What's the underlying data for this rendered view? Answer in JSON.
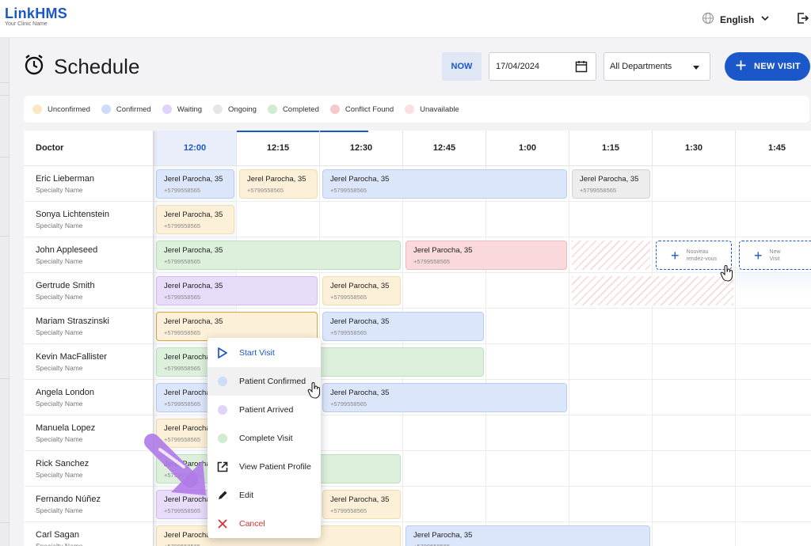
{
  "header": {
    "logo": "LinkHMS",
    "logo_sub": "Your Clinic Name",
    "language": "English"
  },
  "page": {
    "title": "Schedule",
    "now_label": "NOW",
    "date_value": "17/04/2024",
    "department_value": "All Departments",
    "new_visit_label": "NEW VISIT"
  },
  "legend": [
    {
      "label": "Unconfirmed",
      "color": "#fbe7c4"
    },
    {
      "label": "Confirmed",
      "color": "#cfdcf8"
    },
    {
      "label": "Waiting",
      "color": "#e0d2fa"
    },
    {
      "label": "Ongoing",
      "color": "#e6e6e6"
    },
    {
      "label": "Completed",
      "color": "#d2ecd2"
    },
    {
      "label": "Conflict Found",
      "color": "#f6c9cd"
    },
    {
      "label": "Unavailable",
      "color": "#fbe0e2"
    }
  ],
  "grid": {
    "doctor_header": "Doctor",
    "times": [
      "12:00",
      "12:15",
      "12:30",
      "12:45",
      "1:00",
      "1:15",
      "1:30",
      "1:45"
    ],
    "active_time": "12:00",
    "doctors": [
      {
        "name": "Eric Lieberman",
        "specialty": "Specialty Name"
      },
      {
        "name": "Sonya Lichtenstein",
        "specialty": "Specialty Name"
      },
      {
        "name": "John Appleseed",
        "specialty": "Specialty Name"
      },
      {
        "name": "Gertrude Smith",
        "specialty": "Specialty Name"
      },
      {
        "name": "Mariam Straszinski",
        "specialty": "Specialty Name"
      },
      {
        "name": "Kevin MacFallister",
        "specialty": "Specialty Name"
      },
      {
        "name": "Angela London",
        "specialty": "Specialty Name"
      },
      {
        "name": "Manuela Lopez",
        "specialty": "Specialty Name"
      },
      {
        "name": "Rick Sanchez",
        "specialty": "Specialty Name"
      },
      {
        "name": "Fernando Núñez",
        "specialty": "Specialty Name"
      },
      {
        "name": "Carl Sagan",
        "specialty": "Specialty Name"
      }
    ],
    "appointments": [
      {
        "row": 0,
        "start": 0,
        "span": 1,
        "status": "confirmed",
        "patient": "Jerel Parocha, 35",
        "phone": "+5799558565"
      },
      {
        "row": 0,
        "start": 1,
        "span": 1,
        "status": "unconfirmed",
        "patient": "Jerel Parocha, 35",
        "phone": "+5799558565"
      },
      {
        "row": 0,
        "start": 2,
        "span": 3,
        "status": "confirmed",
        "patient": "Jerel Parocha, 35",
        "phone": "+5799558565"
      },
      {
        "row": 0,
        "start": 5,
        "span": 1,
        "status": "ongoing",
        "patient": "Jerel Parocha, 35",
        "phone": "+5799558565"
      },
      {
        "row": 1,
        "start": 0,
        "span": 1,
        "status": "unconfirmed",
        "patient": "Jerel Parocha, 35",
        "phone": "+5799558565"
      },
      {
        "row": 2,
        "start": 0,
        "span": 3,
        "status": "completed",
        "patient": "Jerel Parocha, 35",
        "phone": "+5799558565"
      },
      {
        "row": 2,
        "start": 3,
        "span": 2,
        "status": "conflict",
        "patient": "Jerel Parocha, 35",
        "phone": "+5799558565"
      },
      {
        "row": 3,
        "start": 0,
        "span": 2,
        "status": "waiting",
        "patient": "Jerel Parocha, 35",
        "phone": "+5799558565"
      },
      {
        "row": 3,
        "start": 2,
        "span": 1,
        "status": "unconfirmed",
        "patient": "Jerel Parocha, 35",
        "phone": "+5799558565"
      },
      {
        "row": 4,
        "start": 0,
        "span": 2,
        "status": "unconfirmed",
        "selected": true,
        "patient": "Jerel Parocha, 35",
        "phone": "+5799558565"
      },
      {
        "row": 4,
        "start": 2,
        "span": 2,
        "status": "confirmed",
        "patient": "Jerel Parocha, 35",
        "phone": "+5799558565"
      },
      {
        "row": 5,
        "start": 0,
        "span": 4,
        "status": "completed",
        "patient": "Jerel Parocha, 35",
        "phone": "+5799558565"
      },
      {
        "row": 6,
        "start": 0,
        "span": 2,
        "status": "confirmed",
        "patient": "Jerel Parocha, 35",
        "phone": "+5799558565"
      },
      {
        "row": 6,
        "start": 2,
        "span": 3,
        "status": "confirmed",
        "patient": "Jerel Parocha, 35",
        "phone": "+5799558565"
      },
      {
        "row": 7,
        "start": 0,
        "span": 1,
        "status": "unconfirmed",
        "patient": "Jerel Parocha, 35",
        "phone": "+5799558565"
      },
      {
        "row": 8,
        "start": 0,
        "span": 3,
        "status": "completed",
        "patient": "Jerel Parocha, 35",
        "phone": "+5799558565"
      },
      {
        "row": 9,
        "start": 0,
        "span": 1,
        "status": "waiting",
        "patient": "Jerel Parocha, 35",
        "phone": "+5799558565"
      },
      {
        "row": 9,
        "start": 2,
        "span": 1,
        "status": "unconfirmed",
        "patient": "Jerel Parocha, 35",
        "phone": "+5799558565"
      },
      {
        "row": 10,
        "start": 0,
        "span": 3,
        "status": "unconfirmed",
        "patient": "Jerel Parocha, 35",
        "phone": "+5799558565"
      },
      {
        "row": 10,
        "start": 3,
        "span": 3,
        "status": "confirmed",
        "patient": "Jerel Parocha, 35",
        "phone": "+5799558565"
      }
    ],
    "unavailable": [
      {
        "row": 2,
        "start": 5,
        "span": 1
      },
      {
        "row": 3,
        "start": 5,
        "span": 2
      }
    ],
    "new_slots": [
      {
        "row": 2,
        "start": 6,
        "label_line1": "Nouveau",
        "label_line2": "rendez-vous"
      },
      {
        "row": 2,
        "start": 7,
        "label_line1": "New",
        "label_line2": "Visit"
      }
    ]
  },
  "context_menu": {
    "items": [
      {
        "label": "Start Visit",
        "icon": "play-outline-icon",
        "style": "blue"
      },
      {
        "label": "Patient Confirmed",
        "icon": "confirmed-dot",
        "dot": "#cfdcf8",
        "style": "hover"
      },
      {
        "label": "Patient Arrived",
        "icon": "waiting-dot",
        "dot": "#e0d2fa",
        "style": ""
      },
      {
        "label": "Complete Visit",
        "icon": "completed-dot",
        "dot": "#d2ecd2",
        "style": ""
      },
      {
        "label": "View Patient Profile",
        "icon": "open-in-new-icon",
        "style": ""
      },
      {
        "label": "Edit",
        "icon": "pencil-icon",
        "style": ""
      },
      {
        "label": "Cancel",
        "icon": "close-icon",
        "style": "red"
      }
    ]
  }
}
